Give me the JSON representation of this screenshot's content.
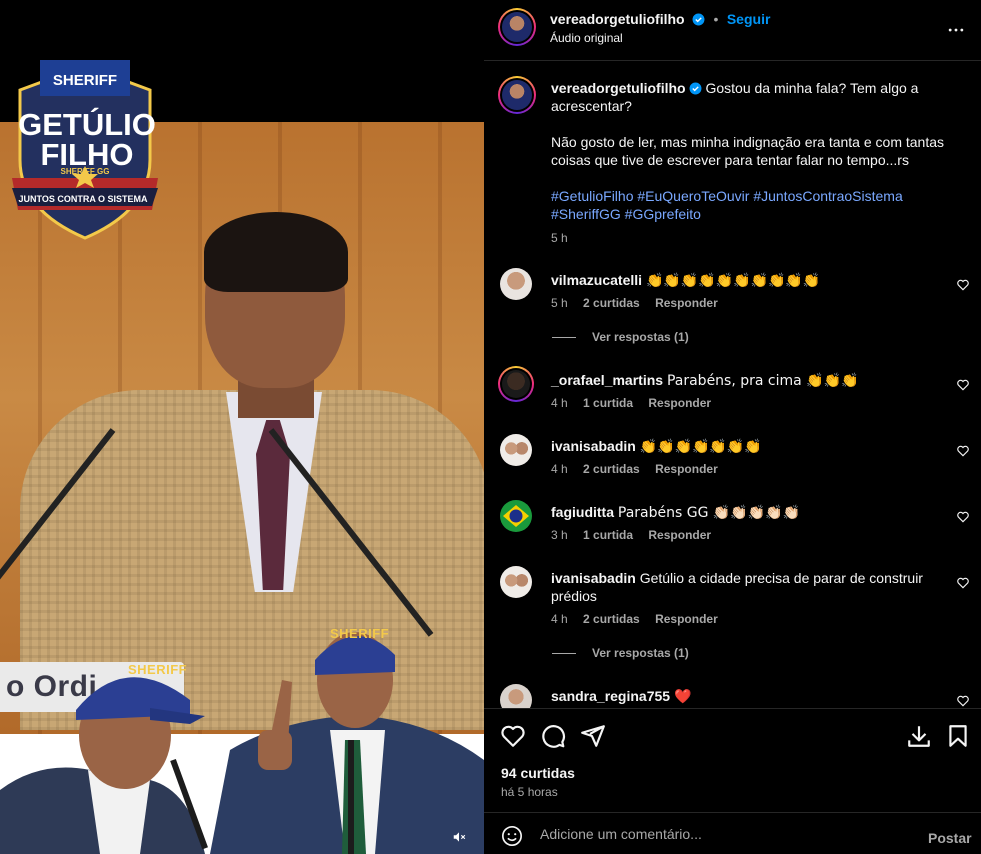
{
  "media": {
    "badge_top": "SHERIFF",
    "badge_title": "GETÚLIO FILHO",
    "badge_sub": "SHERIFF GG",
    "badge_ribbon": "JUNTOS CONTRA O SISTEMA",
    "cap_text_1": "SHERIFF",
    "cap_text_2": "SHERIFF",
    "lower_third": "o Ordi"
  },
  "header": {
    "username": "vereadorgetuliofilho",
    "separator": "•",
    "follow": "Seguir",
    "audio": "Áudio original"
  },
  "caption": {
    "username": "vereadorgetuliofilho",
    "line1": "Gostou da minha fala? Tem algo a acrescentar?",
    "line2": "Não gosto de ler, mas minha indignação era tanta e com tantas coisas que tive de escrever para tentar falar no tempo...rs",
    "hashtags": "#GetulioFilho #EuQueroTeOuvir #JuntosContraoSistema #SheriffGG #GGprefeito",
    "time": "5 h"
  },
  "comments": [
    {
      "user": "vilmazucatelli",
      "text": "👏👏👏👏👏👏👏👏👏👏",
      "time": "5 h",
      "likes": "2 curtidas",
      "reply": "Responder",
      "replies": "Ver respostas (1)"
    },
    {
      "user": "_orafael_martins",
      "text": "Parabéns, pra cima 👏👏👏",
      "time": "4 h",
      "likes": "1 curtida",
      "reply": "Responder"
    },
    {
      "user": "ivanisabadin",
      "text": "👏👏👏👏👏👏👏",
      "time": "4 h",
      "likes": "2 curtidas",
      "reply": "Responder"
    },
    {
      "user": "fagiuditta",
      "text": "Parabéns GG 👏🏻👏🏻👏🏻👏🏻👏🏻",
      "time": "3 h",
      "likes": "1 curtida",
      "reply": "Responder"
    },
    {
      "user": "ivanisabadin",
      "text": "Getúlio a cidade precisa de parar de construir prédios",
      "time": "4 h",
      "likes": "2 curtidas",
      "reply": "Responder",
      "replies": "Ver respostas (1)"
    },
    {
      "user": "sandra_regina755",
      "text": "❤️"
    }
  ],
  "footer": {
    "likes": "94 curtidas",
    "time": "há 5 horas",
    "comment_placeholder": "Adicione um comentário...",
    "post": "Postar"
  },
  "icons": {
    "like": "heart-icon",
    "comment": "comment-icon",
    "share": "send-icon",
    "save": "bookmark-icon",
    "download": "download-icon",
    "more": "more-icon",
    "mute": "muted-speaker-icon",
    "emoji": "emoji-icon",
    "verified": "verified-badge-icon"
  },
  "colors": {
    "accent": "#0095f6",
    "hashtag": "#7aa8ff",
    "muted": "#a8a8a8",
    "heart": "#ff3040"
  }
}
